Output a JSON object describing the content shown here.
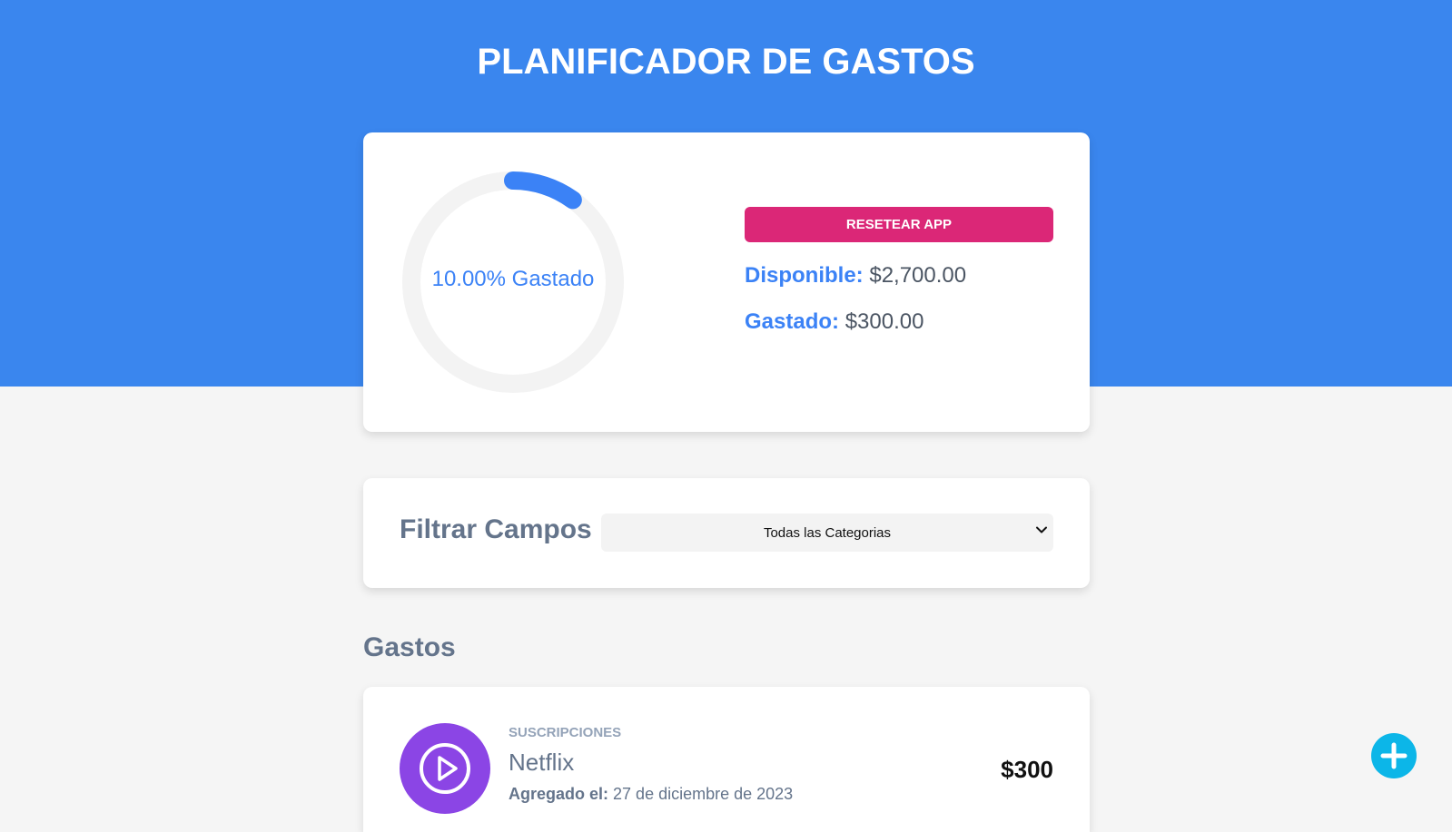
{
  "header": {
    "title": "PLANIFICADOR DE GASTOS",
    "color": "#3a86ee"
  },
  "budget": {
    "progress_percent": 10,
    "progress_text": "10.00% Gastado",
    "reset_label": "RESETEAR APP",
    "available_label": "Disponible:",
    "available_value": "$2,700.00",
    "spent_label": "Gastado:",
    "spent_value": "$300.00",
    "accent_color": "#3b82f6",
    "reset_color": "#db2777"
  },
  "filter": {
    "label": "Filtrar Campos",
    "selected_option": "Todas las Categorias",
    "icon": "chevron-down-icon"
  },
  "expenses": {
    "section_title": "Gastos",
    "items": [
      {
        "category": "SUSCRIPCIONES",
        "name": "Netflix",
        "date_label": "Agregado el:",
        "date_value": "27 de diciembre de 2023",
        "amount": "$300",
        "icon": "play-icon",
        "icon_color": "#8b45e5"
      }
    ]
  },
  "fab": {
    "icon": "plus-icon",
    "color": "#0cb6e8"
  }
}
